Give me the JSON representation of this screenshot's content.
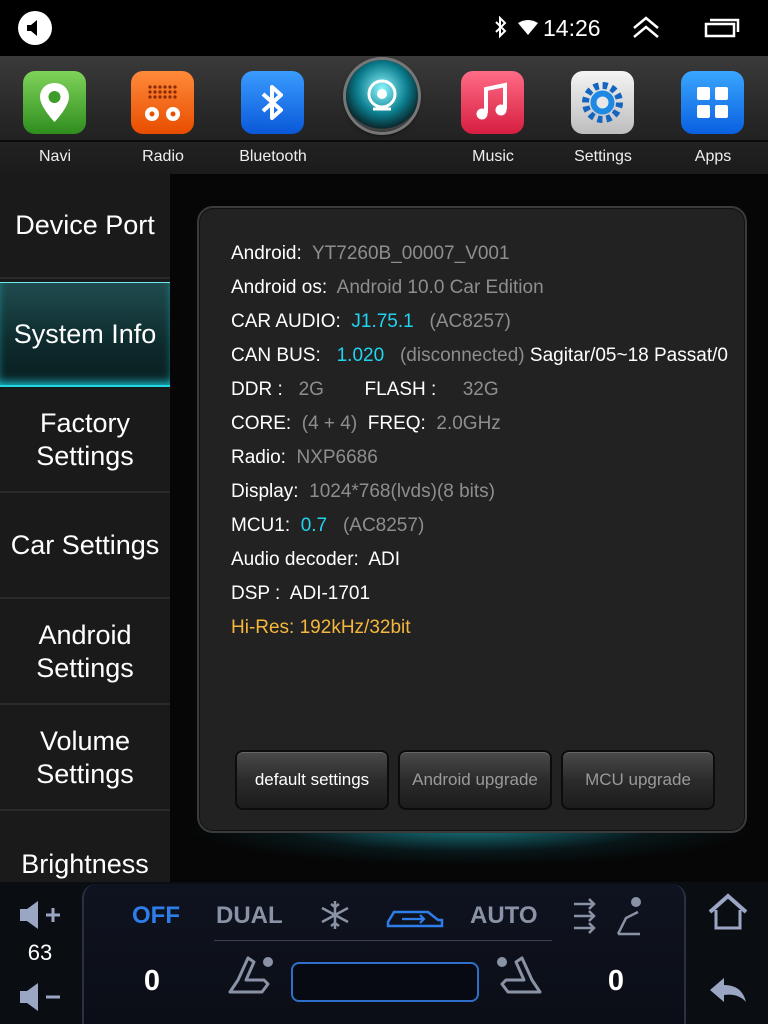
{
  "status": {
    "time": "14:26"
  },
  "dock": {
    "apps": [
      {
        "label": "Navi"
      },
      {
        "label": "Radio"
      },
      {
        "label": "Bluetooth"
      },
      {
        "label": "Music"
      },
      {
        "label": "Settings"
      },
      {
        "label": "Apps"
      }
    ]
  },
  "menu": {
    "items": [
      {
        "label": "Device Port"
      },
      {
        "label": "System Info"
      },
      {
        "label": "Factory\nSettings"
      },
      {
        "label": "Car Settings"
      },
      {
        "label": "Android\nSettings"
      },
      {
        "label": "Volume\nSettings"
      },
      {
        "label": "Brightness"
      }
    ],
    "active": "System Info"
  },
  "info": {
    "android_label": "Android:",
    "android_value": "YT7260B_00007_V001",
    "os_label": "Android os:",
    "os_value": "Android 10.0 Car Edition",
    "car_audio_label": "CAR AUDIO:",
    "car_audio_value": "J1.75.1",
    "car_audio_chip": "(AC8257)",
    "can_bus_label": "CAN BUS:",
    "can_bus_value": "1.020",
    "can_bus_status": "(disconnected)",
    "can_bus_car": "Sagitar/05~18 Passat/0",
    "ddr_label": "DDR :",
    "ddr_value": "2G",
    "flash_label": "FLASH :",
    "flash_value": "32G",
    "core_label": "CORE:",
    "core_value": "(4 + 4)",
    "freq_label": "FREQ:",
    "freq_value": "2.0GHz",
    "radio_label": "Radio:",
    "radio_value": "NXP6686",
    "display_label": "Display:",
    "display_value": "1024*768(lvds)(8 bits)",
    "mcu_label": "MCU1:",
    "mcu_value": "0.7",
    "mcu_chip": "(AC8257)",
    "decoder_label": "Audio decoder:",
    "decoder_value": "ADI",
    "dsp_label": "DSP :",
    "dsp_value": "ADI-1701",
    "hires": "Hi-Res: 192kHz/32bit"
  },
  "buttons": {
    "default": "default settings",
    "android_upgrade": "Android upgrade",
    "mcu_upgrade": "MCU upgrade"
  },
  "climate": {
    "volume": "63",
    "off": "OFF",
    "dual": "DUAL",
    "auto": "AUTO",
    "temp_left": "0",
    "temp_right": "0"
  },
  "colors": {
    "accent_cyan": "#21d4f0",
    "accent_orange": "#f6b73c",
    "climate_blue": "#2d7ee8"
  }
}
